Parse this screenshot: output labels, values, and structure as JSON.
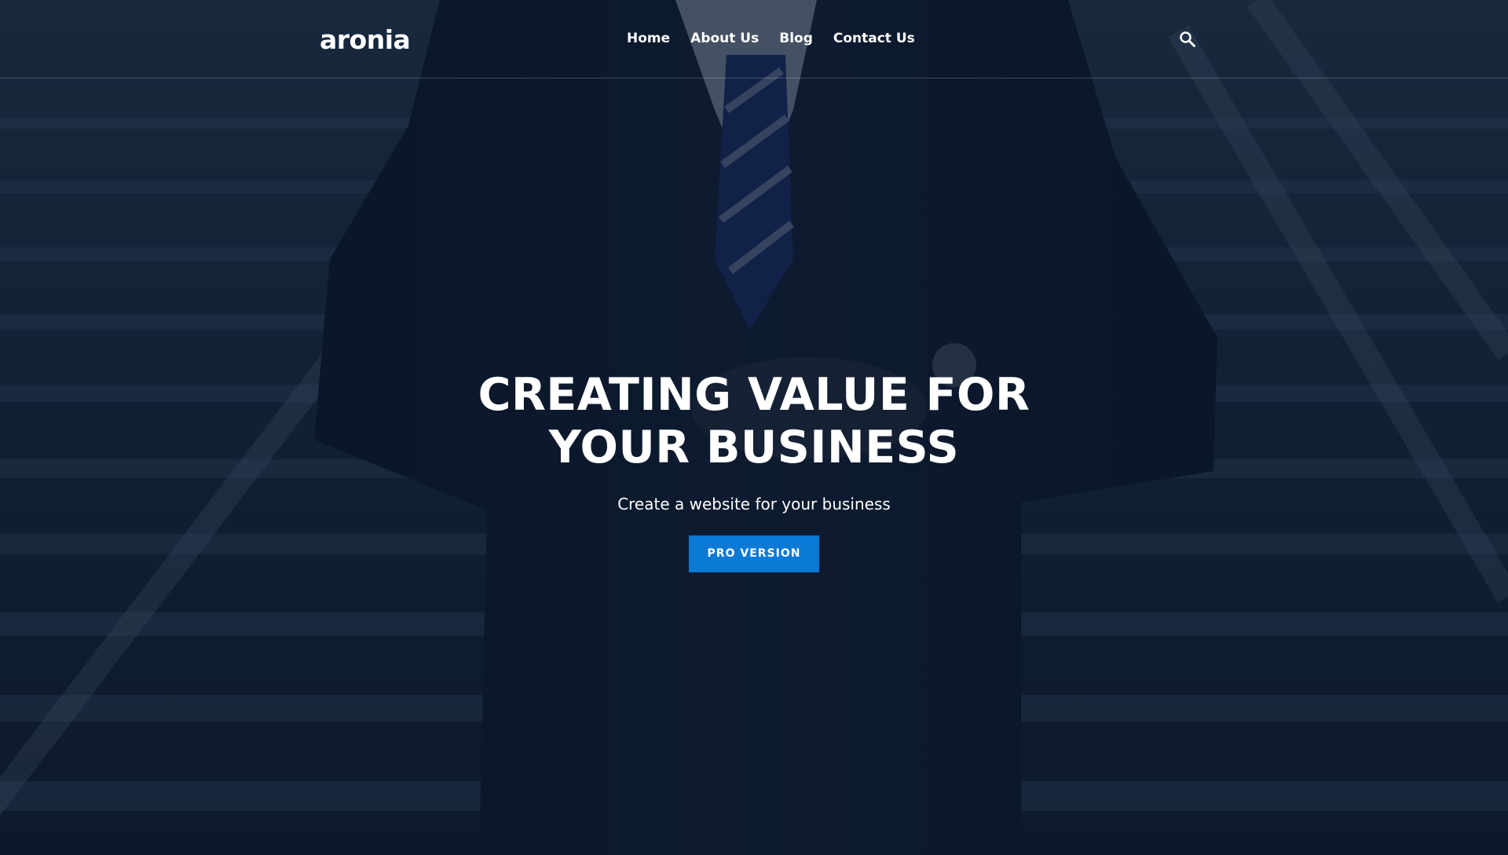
{
  "site": {
    "logo": "aronia"
  },
  "nav": {
    "items": [
      {
        "label": "Home"
      },
      {
        "label": "About Us"
      },
      {
        "label": "Blog"
      },
      {
        "label": "Contact Us"
      }
    ],
    "search_icon": "search-icon"
  },
  "hero": {
    "title_line1": "CREATING VALUE FOR",
    "title_line2": "YOUR BUSINESS",
    "subtitle": "Create a website for your business",
    "cta_label": "PRO VERSION"
  },
  "colors": {
    "accent": "#0b7ad7",
    "overlay": "#0a162a",
    "text": "#ffffff"
  }
}
